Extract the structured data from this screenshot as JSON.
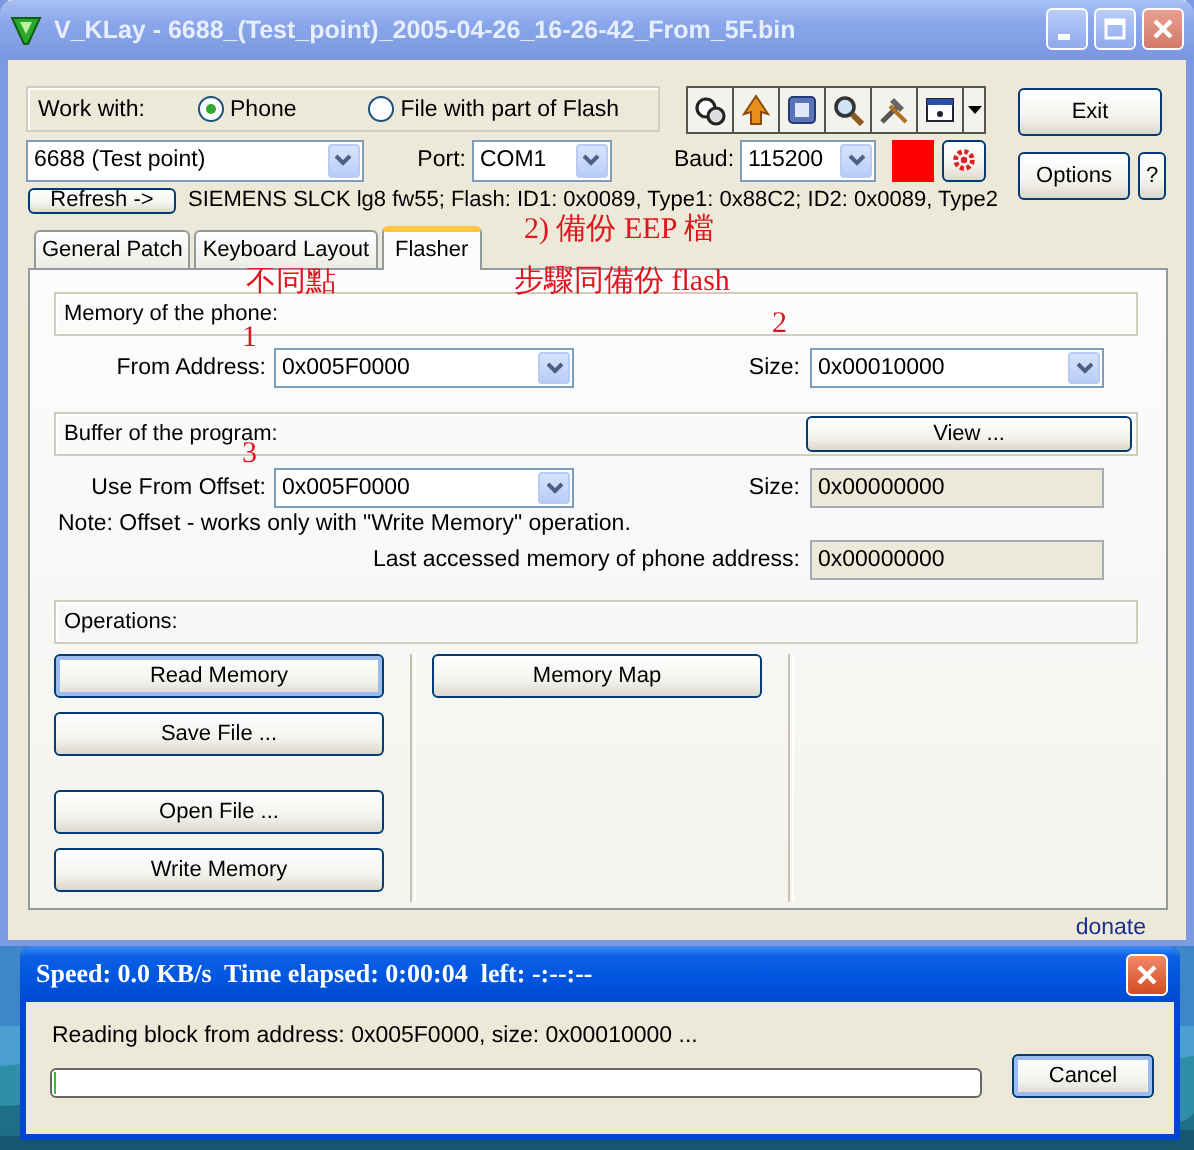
{
  "window": {
    "title": "V_KLay - 6688_(Test_point)_2005-04-26_16-26-42_From_5F.bin"
  },
  "work_with": {
    "label": "Work with:",
    "options": [
      {
        "label": "Phone",
        "selected": true
      },
      {
        "label": "File with part of Flash",
        "selected": false
      }
    ]
  },
  "model": {
    "value": "6688 (Test point)"
  },
  "port": {
    "label": "Port:",
    "value": "COM1"
  },
  "baud": {
    "label": "Baud:",
    "value": "115200"
  },
  "side_buttons": {
    "exit": "Exit",
    "options": "Options",
    "help": "?"
  },
  "refresh_button": "Refresh ->",
  "phone_info": "SIEMENS SLCK lg8 fw55; Flash: ID1: 0x0089, Type1: 0x88C2; ID2: 0x0089, Type2",
  "tabs": [
    {
      "label": "General Patch",
      "selected": false
    },
    {
      "label": "Keyboard Layout",
      "selected": false
    },
    {
      "label": "Flasher",
      "selected": true
    }
  ],
  "memory_of_phone": {
    "heading": "Memory of the phone:",
    "fields": [
      {
        "label": "From Address:",
        "value": "0x005F0000",
        "kind": "dropdown"
      },
      {
        "label": "Size:",
        "value": "0x00010000",
        "kind": "dropdown"
      }
    ]
  },
  "buffer": {
    "heading": "Buffer of the program:",
    "view_button": "View ...",
    "fields": [
      {
        "label": "Use From Offset:",
        "value": "0x005F0000",
        "kind": "dropdown"
      },
      {
        "label": "Size:",
        "value": "0x00000000",
        "kind": "readonly"
      }
    ],
    "note": "Note: Offset - works only with \"Write Memory\" operation.",
    "last_accessed": {
      "label": "Last accessed memory of phone address:",
      "value": "0x00000000",
      "kind": "readonly"
    }
  },
  "operations": {
    "heading": "Operations:",
    "columns": [
      [
        {
          "label": "Read Memory",
          "focused": true
        },
        {
          "label": "Save File ...",
          "focused": false
        },
        {
          "label": "Open File ...",
          "focused": false
        },
        {
          "label": "Write Memory",
          "focused": false
        }
      ],
      [
        {
          "label": "Memory Map",
          "focused": false
        }
      ]
    ]
  },
  "donate_link": "donate",
  "annotations": [
    {
      "text": "2) 備份 EEP 檔"
    },
    {
      "text": "不同點"
    },
    {
      "text": "步驟同備份 flash"
    },
    {
      "text": "1"
    },
    {
      "text": "2"
    },
    {
      "text": "3"
    }
  ],
  "progress_dialog": {
    "title": "Speed: 0.0 KB/s  Time elapsed: 0:00:04  left: -:--:--",
    "message": "Reading block from address: 0x005F0000, size: 0x00010000 ...",
    "level": 0,
    "cancel": "Cancel"
  }
}
